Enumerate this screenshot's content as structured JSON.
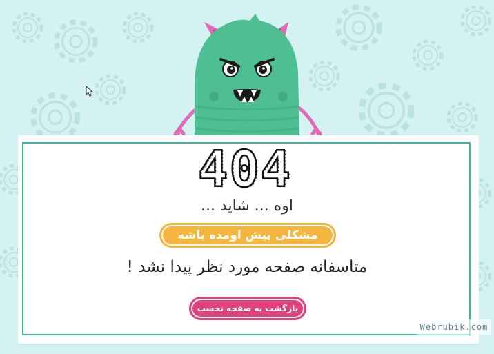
{
  "error": {
    "code": "404",
    "subtitle": "اوه ... شاید ...",
    "badge_text": "مشکلی پیش اومده باشه",
    "message": "متاسفانه صفحه مورد نظر پیدا نشد !",
    "back_button_label": "بازگشت به صفحه نخست"
  },
  "watermark": "Webrubik.com",
  "illustration": {
    "subject": "green-monster",
    "body_color": "#4dbf92",
    "horn_color": "#e06bb8"
  },
  "colors": {
    "background": "#d4f2f1",
    "card_border": "#3cb89a",
    "badge": "#f4b63e",
    "button": "#e2417c"
  },
  "icons": {
    "background": "gear-pattern",
    "cursor": "mouse-cursor-icon"
  }
}
